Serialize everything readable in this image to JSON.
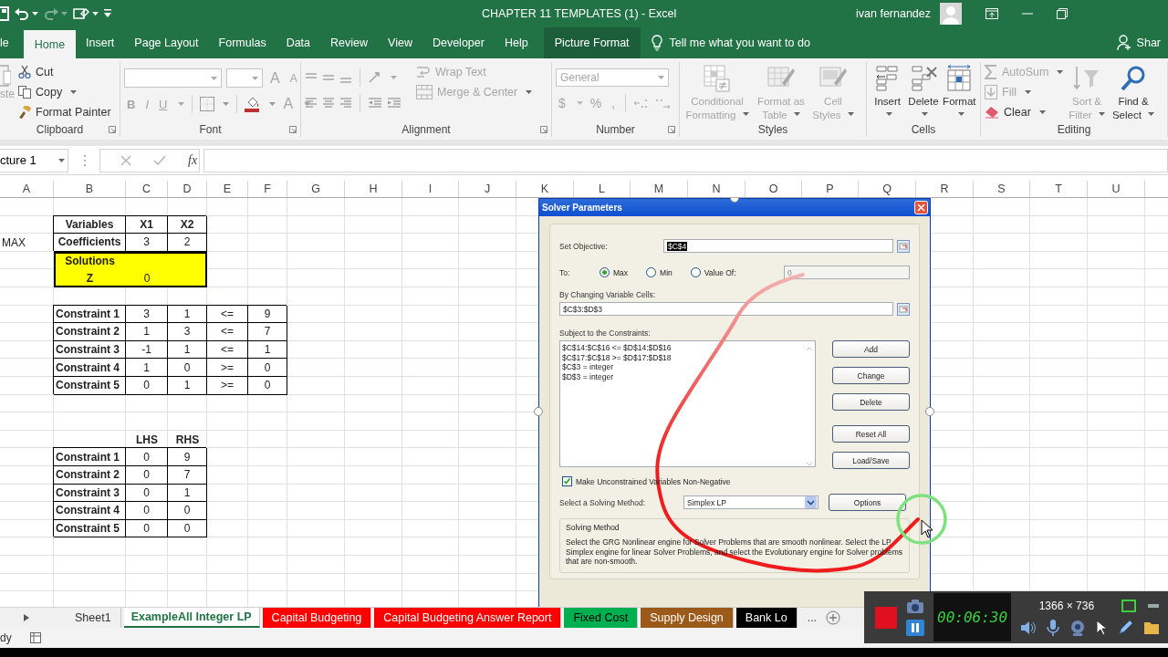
{
  "title_bar": {
    "title": "CHAPTER 11 TEMPLATES (1)  -  Excel",
    "user": "ivan fernandez"
  },
  "ribbon_tabs": [
    {
      "label": "le",
      "selected": false,
      "kind": "tab"
    },
    {
      "label": "Home",
      "selected": true,
      "kind": "tab"
    },
    {
      "label": "Insert",
      "selected": false,
      "kind": "tab"
    },
    {
      "label": "Page Layout",
      "selected": false,
      "kind": "tab"
    },
    {
      "label": "Formulas",
      "selected": false,
      "kind": "tab"
    },
    {
      "label": "Data",
      "selected": false,
      "kind": "tab"
    },
    {
      "label": "Review",
      "selected": false,
      "kind": "tab"
    },
    {
      "label": "View",
      "selected": false,
      "kind": "tab"
    },
    {
      "label": "Developer",
      "selected": false,
      "kind": "tab"
    },
    {
      "label": "Help",
      "selected": false,
      "kind": "tab"
    },
    {
      "label": "Picture Format",
      "selected": false,
      "kind": "contextual"
    }
  ],
  "tell_me": {
    "placeholder": "Tell me what you want to do"
  },
  "share": {
    "label": "Shar"
  },
  "ribbon_groups": [
    {
      "kind": "clipboard",
      "label": "Clipboard",
      "items": [
        {
          "kind": "paste",
          "label": "ste",
          "disabled": true
        },
        {
          "kind": "cut",
          "label": "Cut",
          "disabled": false
        },
        {
          "kind": "copy",
          "label": "Copy",
          "disabled": false
        },
        {
          "kind": "painter",
          "label": "Format Painter",
          "disabled": false
        }
      ]
    },
    {
      "kind": "font",
      "label": "Font",
      "items": [
        {
          "kind": "grow",
          "label": "A",
          "disabled": true
        },
        {
          "kind": "shrink",
          "label": "A",
          "disabled": true
        },
        {
          "kind": "bold",
          "label": "B",
          "disabled": true
        },
        {
          "kind": "italic",
          "label": "I",
          "disabled": true
        },
        {
          "kind": "underline",
          "label": "U",
          "disabled": true
        },
        {
          "kind": "font_color",
          "label": "A",
          "disabled": true
        }
      ]
    },
    {
      "kind": "alignment",
      "label": "Alignment",
      "items": [
        {
          "kind": "wrap",
          "label": "Wrap Text",
          "disabled": true
        },
        {
          "kind": "merge",
          "label": "Merge & Center",
          "disabled": true
        }
      ]
    },
    {
      "kind": "number",
      "label": "Number",
      "items": [
        {
          "kind": "format",
          "label": "General",
          "disabled": true
        },
        {
          "kind": "currency",
          "label": "$",
          "disabled": true
        },
        {
          "kind": "percent",
          "label": "%",
          "disabled": true
        },
        {
          "kind": "comma",
          "label": ",",
          "disabled": true
        }
      ]
    },
    {
      "kind": "styles",
      "label": "Styles",
      "items": [
        {
          "kind": "conditional",
          "label": "Conditional Formatting",
          "disabled": true
        },
        {
          "kind": "table",
          "label": "Format as Table",
          "disabled": true
        },
        {
          "kind": "cellstyles",
          "label": "Cell Styles",
          "disabled": true
        }
      ]
    },
    {
      "kind": "cells",
      "label": "Cells",
      "items": [
        {
          "kind": "insert",
          "label": "Insert",
          "disabled": false
        },
        {
          "kind": "delete",
          "label": "Delete",
          "disabled": false
        },
        {
          "kind": "format",
          "label": "Format",
          "disabled": false
        }
      ]
    },
    {
      "kind": "editing",
      "label": "Editing",
      "items": [
        {
          "kind": "autosum",
          "label": "AutoSum",
          "disabled": true
        },
        {
          "kind": "fill",
          "label": "Fill",
          "disabled": true
        },
        {
          "kind": "clear",
          "label": "Clear",
          "disabled": false
        },
        {
          "kind": "sort",
          "label": "Sort & Filter",
          "disabled": true
        },
        {
          "kind": "find",
          "label": "Find & Select",
          "disabled": false
        }
      ]
    }
  ],
  "formula_bar": {
    "name_box": "cture 1",
    "insert_function": "fx"
  },
  "columns": [
    "A",
    "B",
    "C",
    "D",
    "E",
    "F",
    "G",
    "H",
    "I",
    "J",
    "K",
    "L",
    "M",
    "N",
    "O",
    "P",
    "Q",
    "R",
    "S",
    "T",
    "U"
  ],
  "rows": [
    null,
    [
      null,
      {
        "text": "Variables",
        "bold": true,
        "boxed": true
      },
      {
        "text": "X1",
        "bold": true,
        "boxed": true
      },
      {
        "text": "X2",
        "bold": true,
        "boxed": true
      }
    ],
    [
      {
        "text": "MAX",
        "align_left": true
      },
      {
        "text": "Coefficients",
        "bold": true,
        "boxed": true
      },
      {
        "text": "3",
        "boxed": true
      },
      {
        "text": "2",
        "boxed": true
      }
    ],
    [
      null,
      {
        "text": "Solutions",
        "bold": true,
        "highlight": true
      },
      {
        "highlight": true
      },
      {
        "highlight": true
      }
    ],
    [
      null,
      {
        "text": "Z",
        "bold": true,
        "highlight": true
      },
      {
        "text": "0",
        "highlight": true
      },
      {
        "highlight": true
      }
    ],
    null,
    [
      null,
      {
        "text": "Constraint 1",
        "bold": true,
        "boxed": true,
        "align_left": true
      },
      {
        "text": "3",
        "boxed": true
      },
      {
        "text": "1",
        "boxed": true
      },
      {
        "text": "<=",
        "boxed": true
      },
      {
        "text": "9",
        "boxed": true
      }
    ],
    [
      null,
      {
        "text": "Constraint 2",
        "bold": true,
        "boxed": true,
        "align_left": true
      },
      {
        "text": "1",
        "boxed": true
      },
      {
        "text": "3",
        "boxed": true
      },
      {
        "text": "<=",
        "boxed": true
      },
      {
        "text": "7",
        "boxed": true
      }
    ],
    [
      null,
      {
        "text": "Constraint 3",
        "bold": true,
        "boxed": true,
        "align_left": true
      },
      {
        "text": "-1",
        "boxed": true
      },
      {
        "text": "1",
        "boxed": true
      },
      {
        "text": "<=",
        "boxed": true
      },
      {
        "text": "1",
        "boxed": true
      }
    ],
    [
      null,
      {
        "text": "Constraint 4",
        "bold": true,
        "boxed": true,
        "align_left": true
      },
      {
        "text": "1",
        "boxed": true
      },
      {
        "text": "0",
        "boxed": true
      },
      {
        "text": ">=",
        "boxed": true
      },
      {
        "text": "0",
        "boxed": true
      }
    ],
    [
      null,
      {
        "text": "Constraint 5",
        "bold": true,
        "boxed": true,
        "align_left": true
      },
      {
        "text": "0",
        "boxed": true
      },
      {
        "text": "1",
        "boxed": true
      },
      {
        "text": ">=",
        "boxed": true
      },
      {
        "text": "0",
        "boxed": true
      }
    ],
    null,
    null,
    [
      null,
      null,
      {
        "text": "LHS",
        "bold": true
      },
      {
        "text": "RHS",
        "bold": true
      }
    ],
    [
      null,
      {
        "text": "Constraint 1",
        "bold": true,
        "boxed": true,
        "align_left": true
      },
      {
        "text": "0",
        "boxed": true
      },
      {
        "text": "9",
        "boxed": true
      }
    ],
    [
      null,
      {
        "text": "Constraint 2",
        "bold": true,
        "boxed": true,
        "align_left": true
      },
      {
        "text": "0",
        "boxed": true
      },
      {
        "text": "7",
        "boxed": true
      }
    ],
    [
      null,
      {
        "text": "Constraint 3",
        "bold": true,
        "boxed": true,
        "align_left": true
      },
      {
        "text": "0",
        "boxed": true
      },
      {
        "text": "1",
        "boxed": true
      }
    ],
    [
      null,
      {
        "text": "Constraint 4",
        "bold": true,
        "boxed": true,
        "align_left": true
      },
      {
        "text": "0",
        "boxed": true
      },
      {
        "text": "0",
        "boxed": true
      }
    ],
    [
      null,
      {
        "text": "Constraint 5",
        "bold": true,
        "boxed": true,
        "align_left": true
      },
      {
        "text": "0",
        "boxed": true
      },
      {
        "text": "0",
        "boxed": true
      }
    ],
    null,
    null,
    null,
    null
  ],
  "dialog": {
    "title": "Solver Parameters",
    "objective_label": "Set Objective:",
    "objective": "$C$4",
    "to_label": "To:",
    "targets": [
      {
        "label": "Max",
        "selected": true
      },
      {
        "label": "Min",
        "selected": false
      },
      {
        "label": "Value Of:",
        "selected": false
      }
    ],
    "value_of": "0",
    "changing_label": "By Changing Variable Cells:",
    "changing": "$C$3:$D$3",
    "constraints_label": "Subject to the Constraints:",
    "constraints": [
      "$C$14:$C$16 <= $D$14:$D$16",
      "$C$17:$C$18 >= $D$17:$D$18",
      "$C$3 = integer",
      "$D$3 = integer"
    ],
    "buttons": [
      "Add",
      "Change",
      "Delete",
      "Reset All",
      "Load/Save"
    ],
    "nonnegative": {
      "label": "Make Unconstrained Variables Non-Negative",
      "checked": true
    },
    "method_label": "Select a Solving Method:",
    "method": "Simplex LP",
    "options": "Options",
    "group_title": "Solving Method",
    "description": "Select the GRG Nonlinear engine for Solver Problems that are smooth nonlinear. Select the LP Simplex engine for linear Solver Problems, and select the Evolutionary engine for Solver problems that are non-smooth."
  },
  "sheet_tabs": [
    {
      "label": "Sheet1",
      "selected": false
    },
    {
      "label": "ExampleAll Integer LP",
      "selected": true
    },
    {
      "label": "Capital Budgeting",
      "selected": false,
      "color": "#ff0000"
    },
    {
      "label": "Capital Budgeting Answer Report",
      "selected": false,
      "color": "#ff0000"
    },
    {
      "label": "Fixed Cost",
      "selected": false,
      "color": "#00b050"
    },
    {
      "label": "Supply Design",
      "selected": false,
      "color": "#9c5a1a"
    },
    {
      "label": "Bank Lo",
      "selected": false,
      "color": "#000000"
    }
  ],
  "more_tabs": "...",
  "status_bar": {
    "text": "dy"
  },
  "recorder": {
    "timer": "00:06:30",
    "resolution": "1366 × 736"
  }
}
